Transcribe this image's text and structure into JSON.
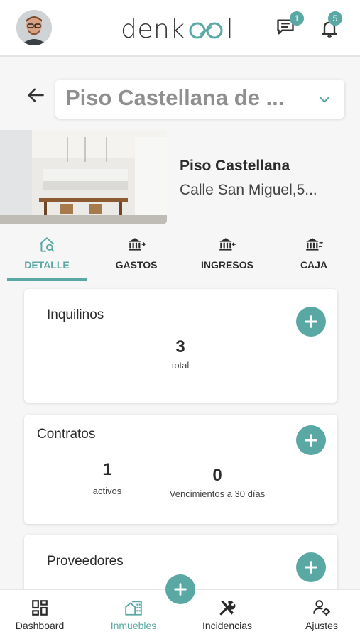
{
  "header": {
    "logo_prefix": "denk",
    "logo_suffix": "l",
    "messages_badge": "1",
    "notifications_badge": "5"
  },
  "property": {
    "selector_value": "Piso Castellana de ...",
    "name": "Piso Castellana",
    "address": "Calle San Miguel,5..."
  },
  "tabs": [
    {
      "label": "DETALLE",
      "icon": "house-search-icon",
      "active": true
    },
    {
      "label": "GASTOS",
      "icon": "bank-out-icon",
      "active": false
    },
    {
      "label": "INGRESOS",
      "icon": "bank-in-icon",
      "active": false
    },
    {
      "label": "CAJA",
      "icon": "bank-transfer-icon",
      "active": false
    }
  ],
  "cards": {
    "tenants": {
      "title": "Inquilinos",
      "value": "3",
      "value_label": "total"
    },
    "contracts": {
      "title": "Contratos",
      "active_value": "1",
      "active_label": "activos",
      "expiring_value": "0",
      "expiring_label": "Vencimientos a 30 días"
    },
    "providers": {
      "title": "Proveedores"
    }
  },
  "bottom_nav": [
    {
      "label": "Dashboard",
      "icon": "dashboard-icon",
      "active": false
    },
    {
      "label": "Inmuebles",
      "icon": "building-icon",
      "active": true
    },
    {
      "label": "Incidencias",
      "icon": "tools-icon",
      "active": false
    },
    {
      "label": "Ajustes",
      "icon": "user-settings-icon",
      "active": false
    }
  ],
  "colors": {
    "accent": "#5aa8a4",
    "text": "#2b2b2b",
    "muted": "#8f8f8f"
  }
}
